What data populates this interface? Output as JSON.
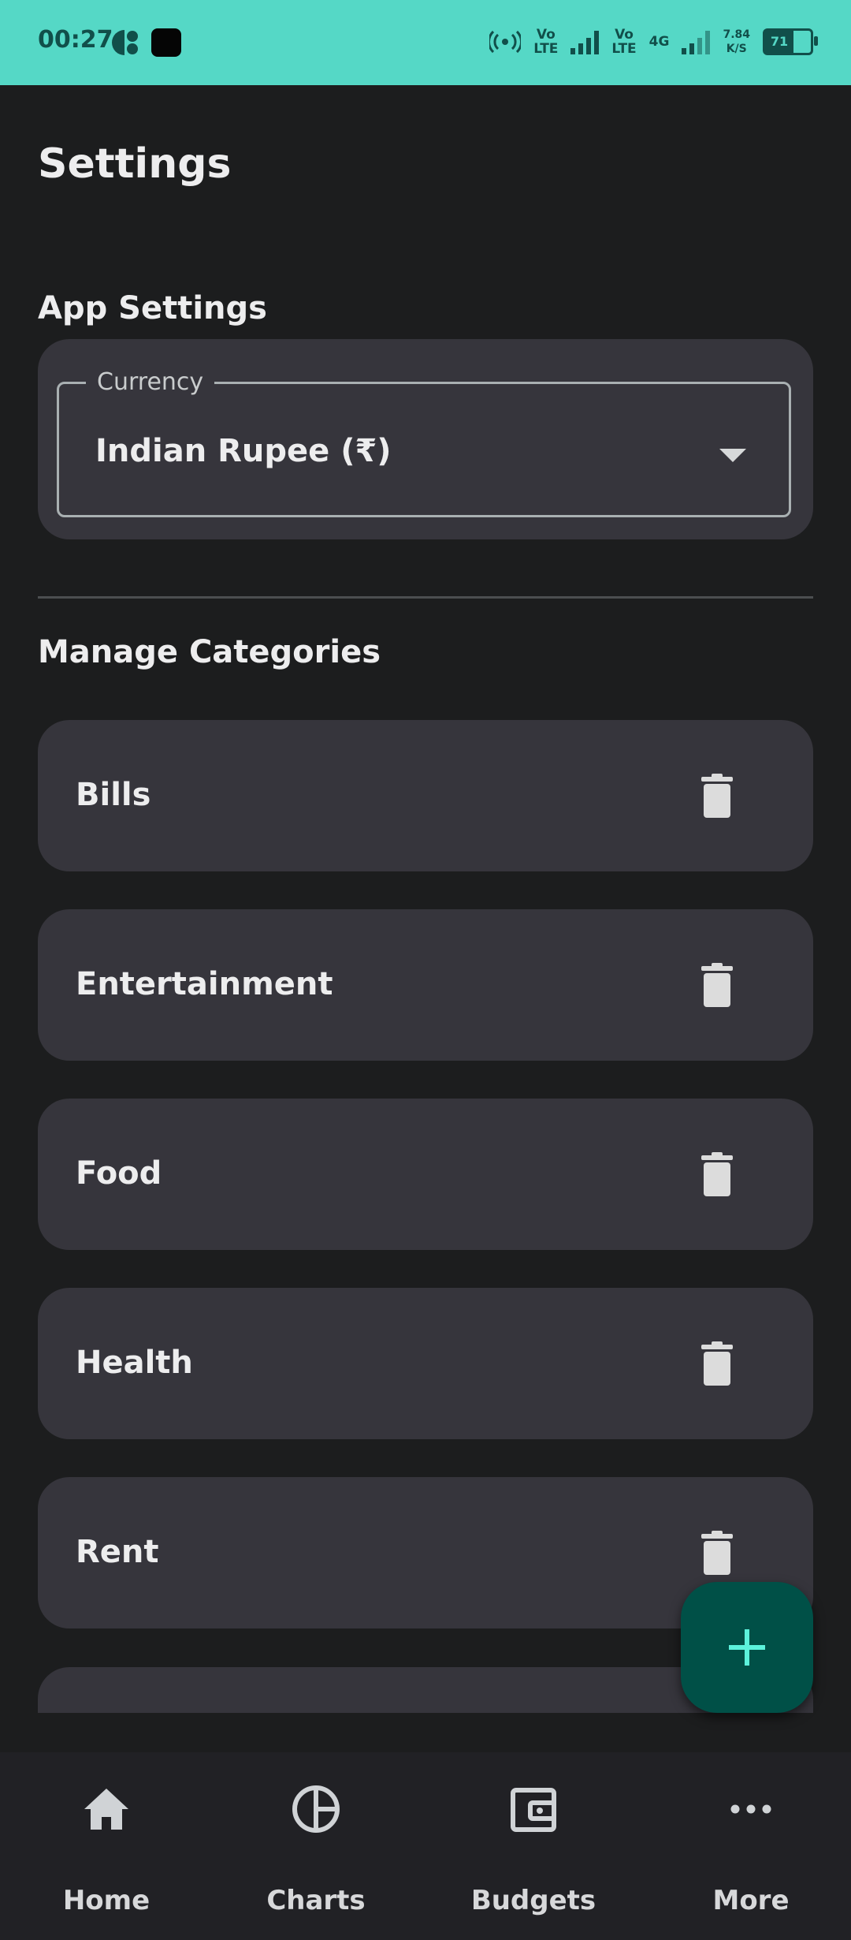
{
  "status_bar": {
    "time": "00:27",
    "lte1": "Vo\nLTE",
    "lte2": "Vo\nLTE",
    "net": "4G",
    "speed_value": "7.84",
    "speed_unit": "K/S",
    "battery": "71",
    "color": "#55d8c6"
  },
  "page": {
    "title": "Settings"
  },
  "app_settings": {
    "heading": "App Settings",
    "currency_label": "Currency",
    "currency_value": "Indian Rupee (₹)"
  },
  "categories": {
    "heading": "Manage Categories",
    "items": [
      {
        "name": "Bills"
      },
      {
        "name": "Entertainment"
      },
      {
        "name": "Food"
      },
      {
        "name": "Health"
      },
      {
        "name": "Rent"
      }
    ]
  },
  "fab": {
    "icon": "plus-icon",
    "color": "#005047",
    "icon_color": "#5cf2dc"
  },
  "bottom_nav": {
    "items": [
      {
        "label": "Home",
        "icon": "home-icon"
      },
      {
        "label": "Charts",
        "icon": "chart-icon"
      },
      {
        "label": "Budgets",
        "icon": "wallet-icon"
      },
      {
        "label": "More",
        "icon": "more-icon"
      }
    ]
  }
}
